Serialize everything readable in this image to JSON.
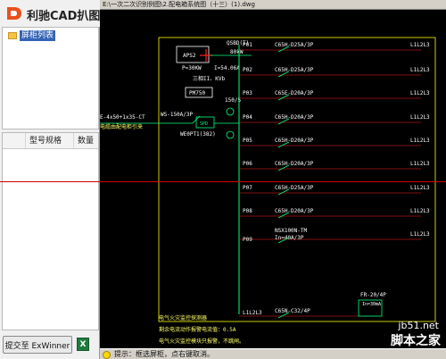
{
  "app": {
    "title": "利驰CAD扒图"
  },
  "tree": {
    "root_label": "屏柜列表"
  },
  "table": {
    "columns": [
      "",
      "型号规格",
      "数量"
    ]
  },
  "footer": {
    "submit_label": "提交至 ExWinner",
    "excel_icon": "excel-icon"
  },
  "drawing": {
    "path": "E:\\一次二次识别例图\\2.配电箱系统图（十三）(1).dwg",
    "status": "提示：框选屏柜，点右键取消。",
    "title_block": [
      "QSBD(T)",
      "80kW"
    ],
    "apsb": "APS2",
    "meter": "PM750",
    "ratio": "150/5",
    "power_p": "P=30KW",
    "power_i": "I=54.06A",
    "phase": "三相II、KVb",
    "cable_in": "E-4x50+1x35-CT",
    "cable_note": "电缆由配电柜引来",
    "breaker_main": "WS-150A/3P",
    "breaker_model": "WE0PT1(382)",
    "spd": "SPD",
    "circuits": [
      {
        "id": "P01",
        "spec": "C65H-D25A/3P",
        "load": "L1L2L3"
      },
      {
        "id": "P02",
        "spec": "C65H-D25A/3P",
        "load": "L1L2L3"
      },
      {
        "id": "P03",
        "spec": "C65E-D20A/3P",
        "load": "L1L2L3"
      },
      {
        "id": "P04",
        "spec": "C65H-D20A/3P",
        "load": "L1L2L3"
      },
      {
        "id": "P05",
        "spec": "C65H-D20A/3P",
        "load": "L1L2L3"
      },
      {
        "id": "P06",
        "spec": "C65H-D20A/3P",
        "load": "L1L2L3"
      },
      {
        "id": "P07",
        "spec": "C65H-D25A/3P",
        "load": "L1L2L3"
      },
      {
        "id": "P08",
        "spec": "C65H-D20A/3P",
        "load": "L1L2L3"
      },
      {
        "id": "P09",
        "spec": "NSX100N-TM",
        "spec2": "In=40A/3P",
        "load": "L1L2L3"
      }
    ],
    "last_left": "L1L2L3",
    "last_spec": "C65N-C32/4P",
    "fr": "FR-20/4P",
    "fr_sub": "In=30mA",
    "fire_title": "电气火灾监控探测器",
    "fire_line1": "剩余电流动作报警电流值：0.5A",
    "fire_line2": "电气火灾监控模块只报警，不跳闸。"
  },
  "watermark": {
    "site": "jb51.net",
    "brand": "脚本之家"
  },
  "colors": {
    "wire": "#00ff7f",
    "bus": "#ffff00",
    "red": "#ff2020",
    "text": "#ffffff",
    "label": "#ffff66"
  }
}
